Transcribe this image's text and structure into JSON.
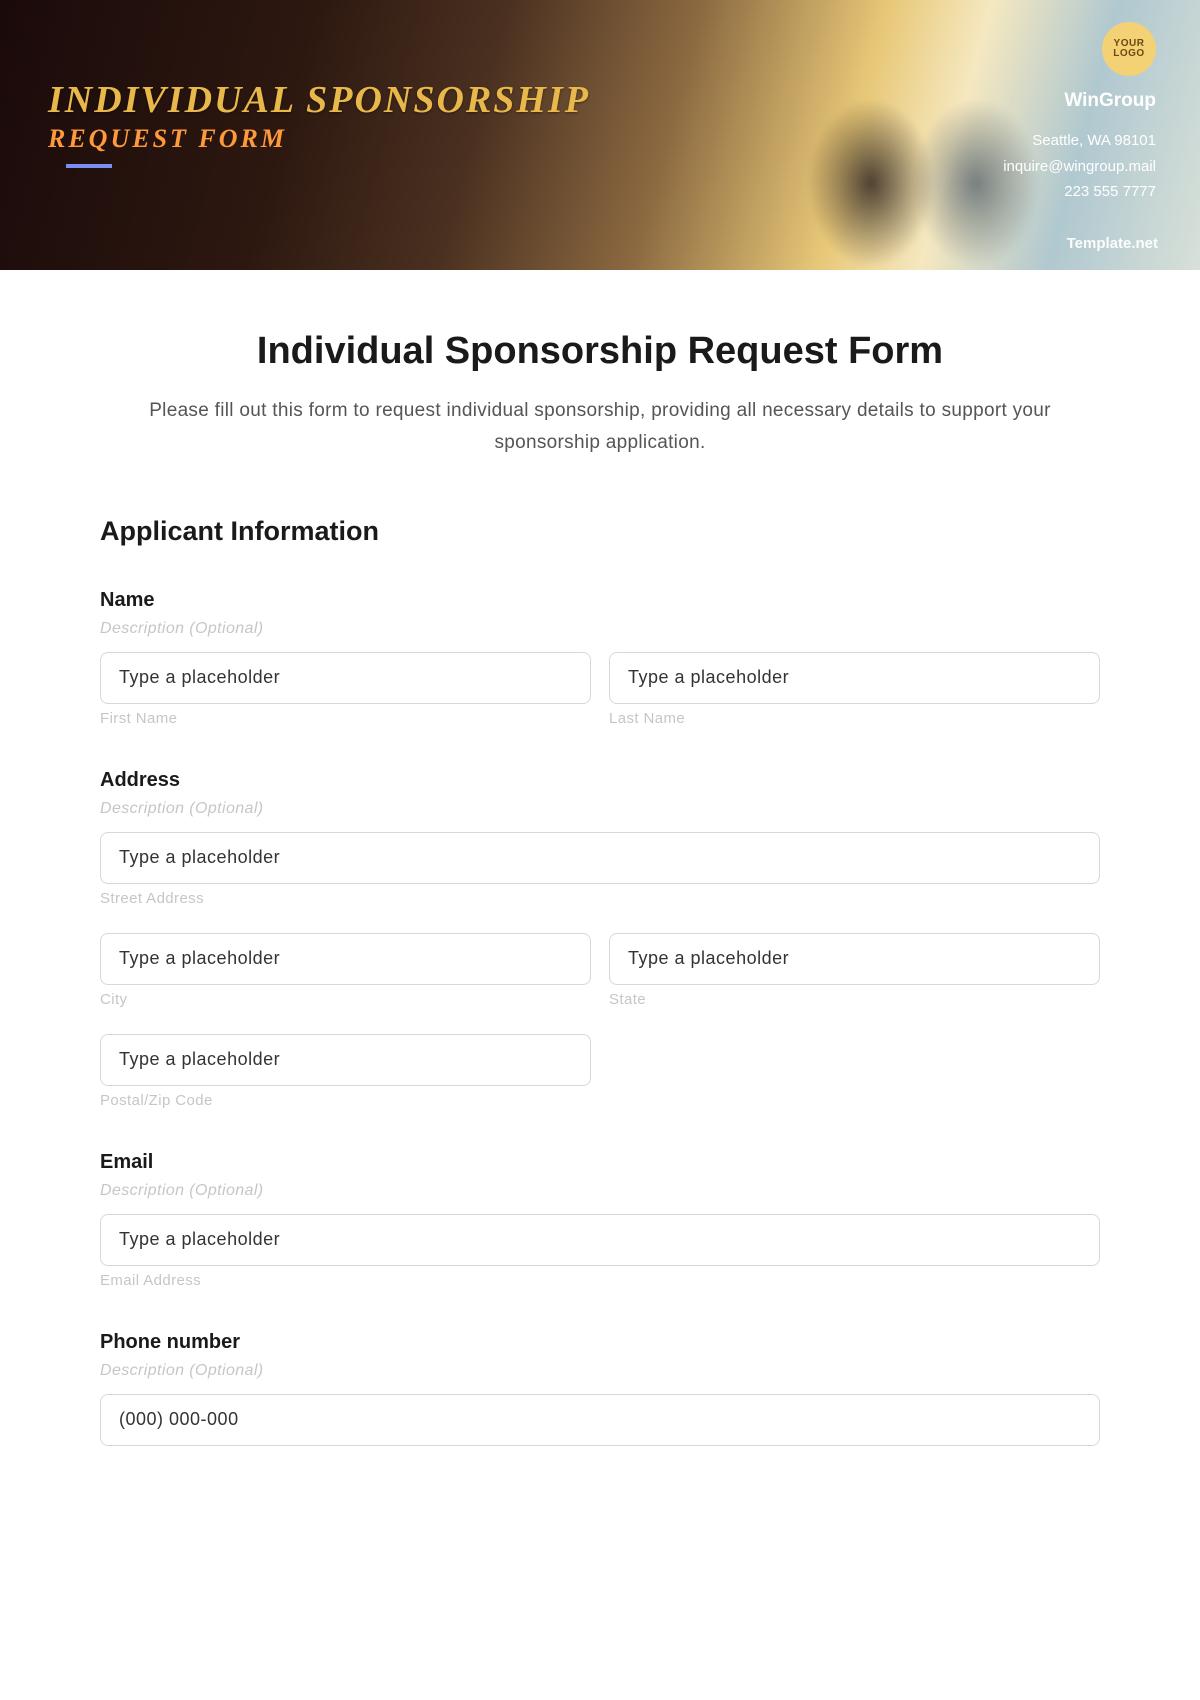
{
  "hero": {
    "title": "INDIVIDUAL SPONSORSHIP",
    "subtitle": "REQUEST FORM",
    "logo_top": "YOUR",
    "logo_bottom": "LOGO",
    "company": "WinGroup",
    "address": "Seattle, WA 98101",
    "email": "inquire@wingroup.mail",
    "phone": "223 555 7777",
    "watermark": "Template.net"
  },
  "form": {
    "title": "Individual Sponsorship Request Form",
    "description": "Please fill out this form to request individual sponsorship, providing all necessary details to support your sponsorship application.",
    "section_applicant": "Applicant Information",
    "desc_optional": "Description (Optional)",
    "placeholder": "Type a placeholder",
    "name": {
      "label": "Name",
      "first": "First Name",
      "last": "Last Name"
    },
    "address": {
      "label": "Address",
      "street": "Street Address",
      "city": "City",
      "state": "State",
      "postal": "Postal/Zip Code"
    },
    "email": {
      "label": "Email",
      "sub": "Email Address"
    },
    "phone": {
      "label": "Phone number",
      "placeholder": "(000) 000-000"
    }
  }
}
